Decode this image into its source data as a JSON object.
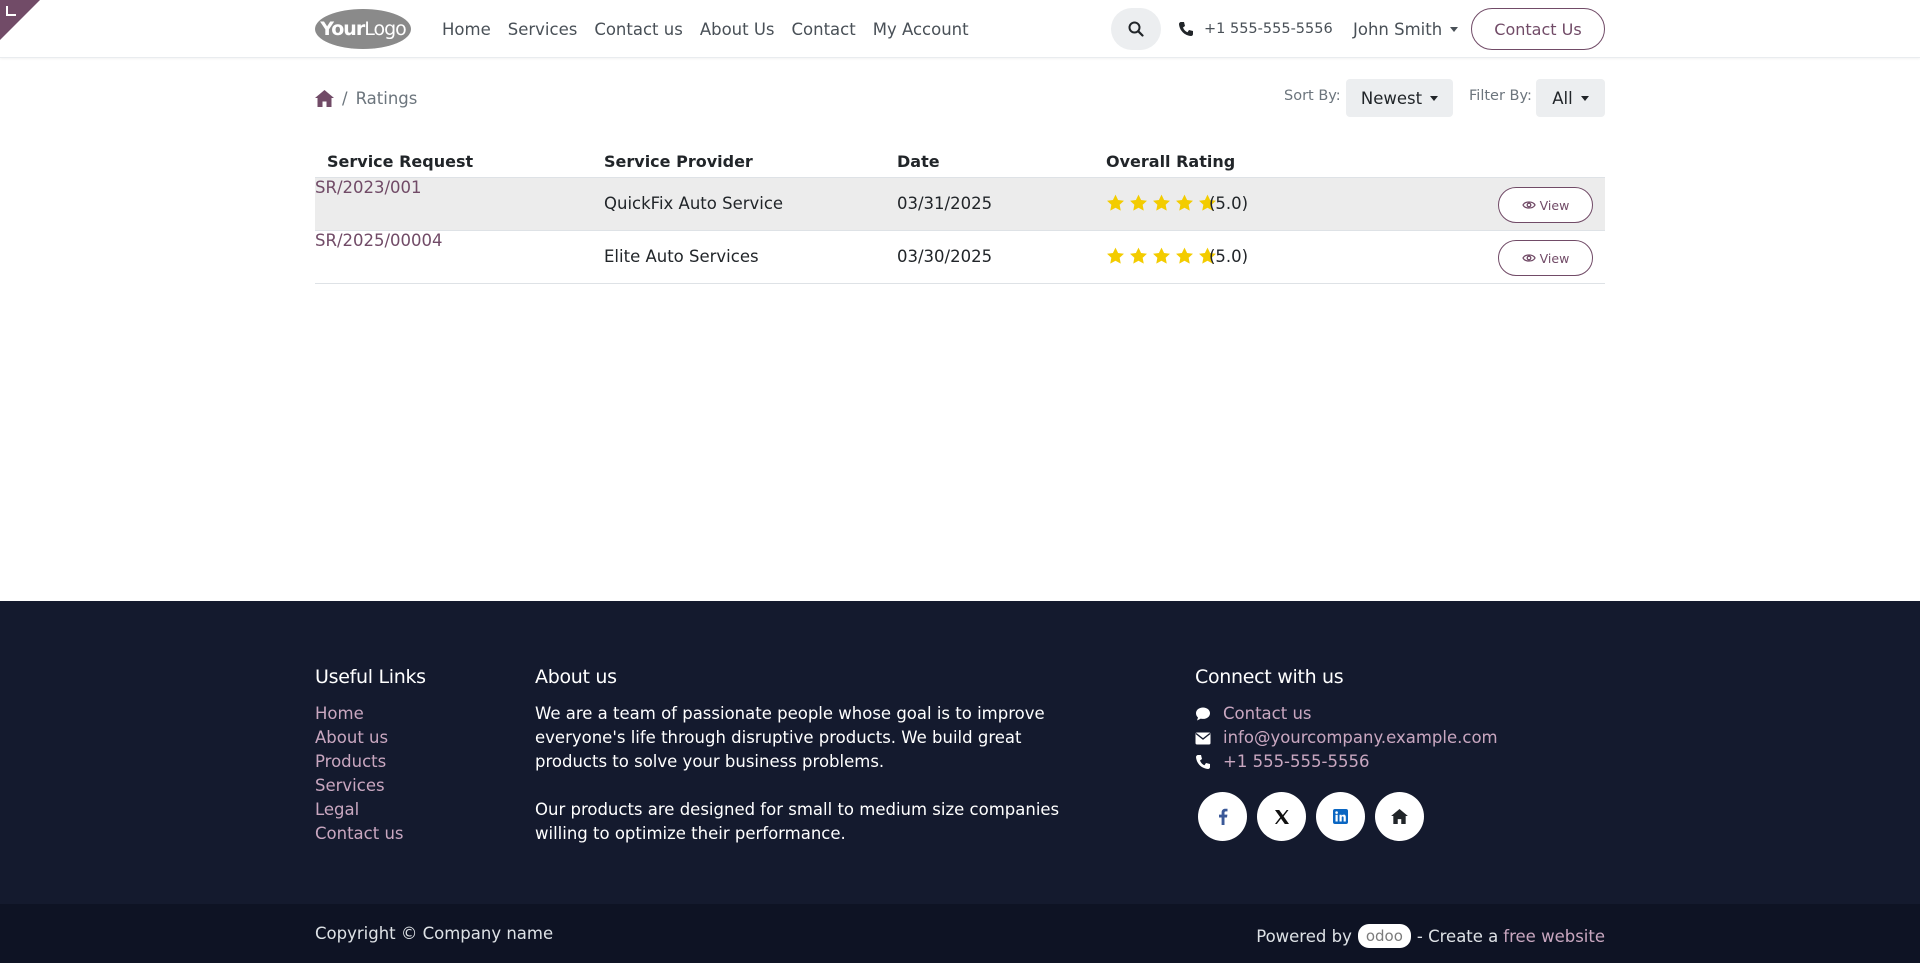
{
  "header": {
    "logo_bold": "Your",
    "logo_thin": "Logo",
    "nav": [
      "Home",
      "Services",
      "Contact us",
      "About Us",
      "Contact",
      "My Account"
    ],
    "phone": "+1 555-555-5556",
    "user": "John Smith",
    "contact_button": "Contact Us"
  },
  "breadcrumb": {
    "separator": "/",
    "current": "Ratings"
  },
  "filters": {
    "sort_label": "Sort By:",
    "sort_value": "Newest",
    "filter_label": "Filter By:",
    "filter_value": "All"
  },
  "table": {
    "headers": [
      "Service Request",
      "Service Provider",
      "Date",
      "Overall Rating"
    ],
    "rows": [
      {
        "request": "SR/2023/001",
        "provider": "QuickFix Auto Service",
        "date": "03/31/2025",
        "stars": 5,
        "score": "(5.0)",
        "action": "View"
      },
      {
        "request": "SR/2025/00004",
        "provider": "Elite Auto Services",
        "date": "03/30/2025",
        "stars": 5,
        "score": "(5.0)",
        "action": "View"
      }
    ]
  },
  "footer": {
    "useful_links_title": "Useful Links",
    "useful_links": [
      "Home",
      "About us",
      "Products",
      "Services",
      "Legal",
      "Contact us"
    ],
    "about_title": "About us",
    "about_p1": "We are a team of passionate people whose goal is to improve everyone's life through disruptive products. We build great products to solve your business problems.",
    "about_p2": "Our products are designed for small to medium size companies willing to optimize their performance.",
    "connect_title": "Connect with us",
    "connect_contact": "Contact us",
    "connect_email": "info@yourcompany.example.com",
    "connect_phone": "+1 555-555-5556",
    "socials": [
      "facebook-icon",
      "x-icon",
      "linkedin-icon",
      "home-icon"
    ]
  },
  "bottom": {
    "copyright": "Copyright © Company name",
    "powered_by": "Powered by",
    "odoo": "odoo",
    "create_text": "- Create a",
    "free_website": "free website"
  },
  "colors": {
    "primary": "#714B67",
    "footer_bg": "#141a2e",
    "star": "#f3cc00"
  }
}
